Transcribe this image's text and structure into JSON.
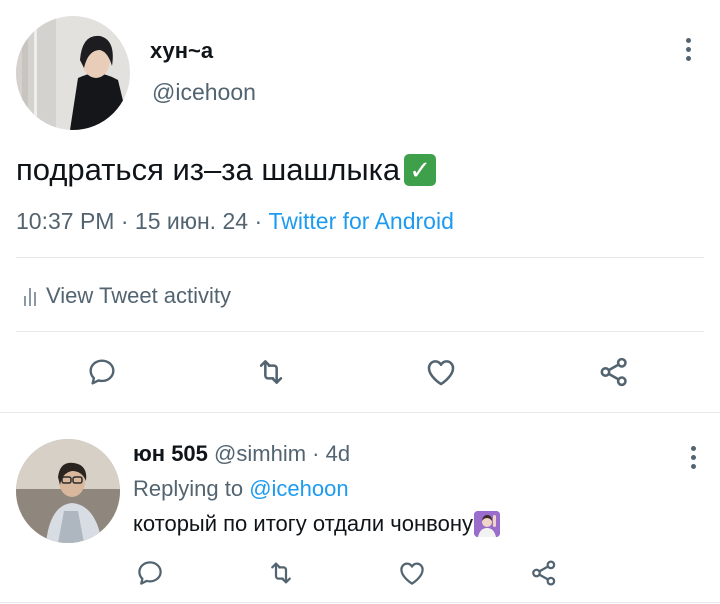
{
  "tweet": {
    "display_name": "хун~а",
    "handle": "@icehoon",
    "text": "подраться из–за шашлыка",
    "text_emoji": "check-mark-button-emoji",
    "time": "10:37 PM",
    "date": "15 июн. 24",
    "separator": "·",
    "source": "Twitter for Android",
    "activity_label": "View Tweet activity"
  },
  "reply": {
    "display_name": "юн 505",
    "handle": "@simhim",
    "separator": "·",
    "age": "4d",
    "replying_prefix": "Replying to",
    "replying_handle": "@icehoon",
    "text": "который по итогу отдали чонвону",
    "text_emoji": "person-raising-hand-emoji"
  },
  "icons": {
    "reply": "reply-icon",
    "retweet": "retweet-icon",
    "like": "like-icon",
    "share": "share-icon",
    "more": "more-icon",
    "activity": "bar-chart-icon"
  },
  "colors": {
    "link": "#1d9bf0",
    "muted": "#536471",
    "text": "#0f1419",
    "divider": "#e6e9ec",
    "check": "#3fa04b"
  }
}
